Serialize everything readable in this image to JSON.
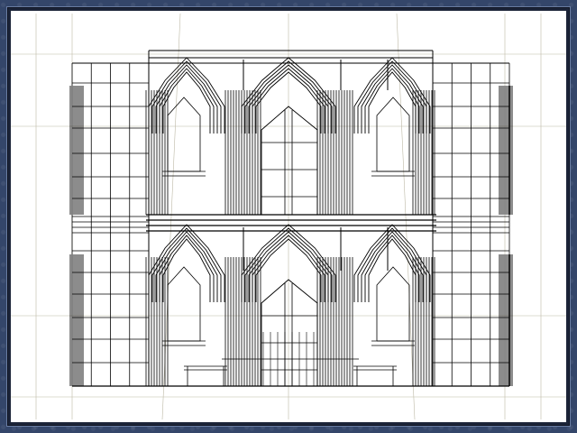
{
  "viewport": {
    "mode": "wireframe",
    "background_color": "#ffffff",
    "line_color": "#000000",
    "guide_color": "#bdb9a6"
  },
  "frame": {
    "border_color": "#34466a"
  },
  "model": {
    "stories": 2,
    "bays_per_story": 3
  }
}
